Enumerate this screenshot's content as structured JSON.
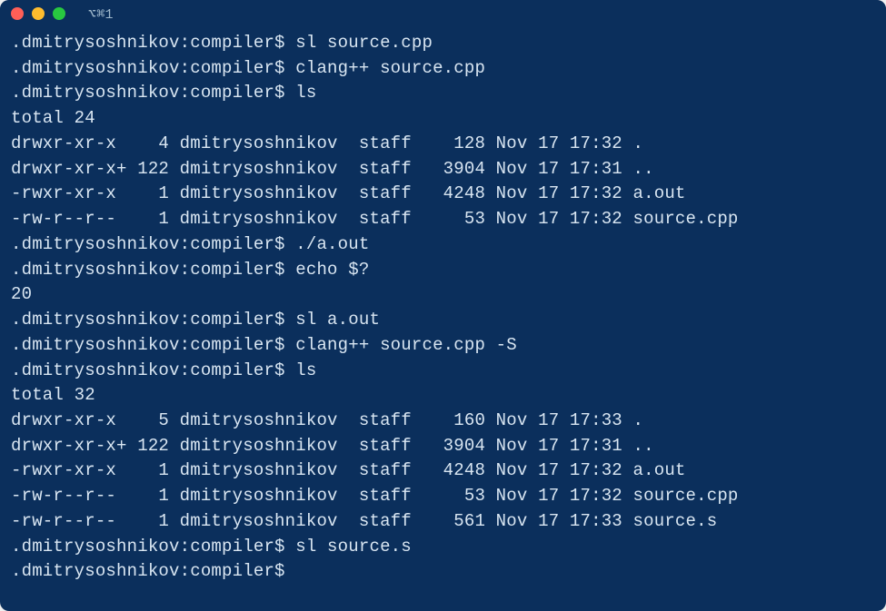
{
  "title": "⌥⌘1",
  "prompt": ".dmitrysoshnikov:compiler$ ",
  "lines": [
    {
      "t": "cmd",
      "cmd": "sl source.cpp"
    },
    {
      "t": "cmd",
      "cmd": "clang++ source.cpp"
    },
    {
      "t": "cmd",
      "cmd": "ls"
    },
    {
      "t": "out",
      "text": "total 24"
    },
    {
      "t": "ls",
      "perm": "drwxr-xr-x ",
      "n": "  4",
      "own": "dmitrysoshnikov",
      "grp": "staff",
      "size": "  128",
      "date": "Nov 17 17:32",
      "name": "."
    },
    {
      "t": "ls",
      "perm": "drwxr-xr-x+",
      "n": "122",
      "own": "dmitrysoshnikov",
      "grp": "staff",
      "size": " 3904",
      "date": "Nov 17 17:31",
      "name": ".."
    },
    {
      "t": "ls",
      "perm": "-rwxr-xr-x ",
      "n": "  1",
      "own": "dmitrysoshnikov",
      "grp": "staff",
      "size": " 4248",
      "date": "Nov 17 17:32",
      "name": "a.out"
    },
    {
      "t": "ls",
      "perm": "-rw-r--r-- ",
      "n": "  1",
      "own": "dmitrysoshnikov",
      "grp": "staff",
      "size": "   53",
      "date": "Nov 17 17:32",
      "name": "source.cpp"
    },
    {
      "t": "cmd",
      "cmd": "./a.out"
    },
    {
      "t": "cmd",
      "cmd": "echo $?"
    },
    {
      "t": "out",
      "text": "20"
    },
    {
      "t": "cmd",
      "cmd": "sl a.out"
    },
    {
      "t": "cmd",
      "cmd": "clang++ source.cpp -S"
    },
    {
      "t": "cmd",
      "cmd": "ls"
    },
    {
      "t": "out",
      "text": "total 32"
    },
    {
      "t": "ls",
      "perm": "drwxr-xr-x ",
      "n": "  5",
      "own": "dmitrysoshnikov",
      "grp": "staff",
      "size": "  160",
      "date": "Nov 17 17:33",
      "name": "."
    },
    {
      "t": "ls",
      "perm": "drwxr-xr-x+",
      "n": "122",
      "own": "dmitrysoshnikov",
      "grp": "staff",
      "size": " 3904",
      "date": "Nov 17 17:31",
      "name": ".."
    },
    {
      "t": "ls",
      "perm": "-rwxr-xr-x ",
      "n": "  1",
      "own": "dmitrysoshnikov",
      "grp": "staff",
      "size": " 4248",
      "date": "Nov 17 17:32",
      "name": "a.out"
    },
    {
      "t": "ls",
      "perm": "-rw-r--r-- ",
      "n": "  1",
      "own": "dmitrysoshnikov",
      "grp": "staff",
      "size": "   53",
      "date": "Nov 17 17:32",
      "name": "source.cpp"
    },
    {
      "t": "ls",
      "perm": "-rw-r--r-- ",
      "n": "  1",
      "own": "dmitrysoshnikov",
      "grp": "staff",
      "size": "  561",
      "date": "Nov 17 17:33",
      "name": "source.s"
    },
    {
      "t": "cmd",
      "cmd": "sl source.s"
    },
    {
      "t": "cmd",
      "cmd": ""
    }
  ]
}
